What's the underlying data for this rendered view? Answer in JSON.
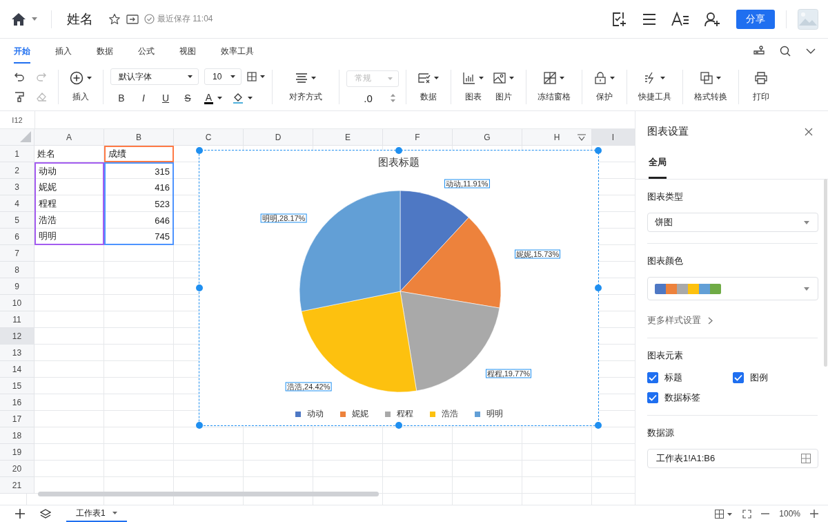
{
  "header": {
    "title": "姓名",
    "save_status": "最近保存 11:04",
    "share_button": "分享"
  },
  "tabs": [
    {
      "label": "开始",
      "selected": true
    },
    {
      "label": "插入",
      "selected": false
    },
    {
      "label": "数据",
      "selected": false
    },
    {
      "label": "公式",
      "selected": false
    },
    {
      "label": "视图",
      "selected": false
    },
    {
      "label": "效率工具",
      "selected": false
    }
  ],
  "toolbar": {
    "history": [
      {
        "kind": "undo",
        "disabled": false
      },
      {
        "kind": "redo",
        "disabled": true
      },
      {
        "kind": "painter",
        "disabled": false
      },
      {
        "kind": "eraser",
        "disabled": true
      }
    ],
    "insert_button": "插入",
    "font_select": "默认字体",
    "size_select": "10",
    "format_buttons": [
      {
        "label": "B",
        "kind": "bold"
      },
      {
        "label": "I",
        "kind": "italic"
      },
      {
        "label": "U",
        "kind": "underline"
      },
      {
        "label": "S",
        "kind": "strike"
      },
      {
        "label": "A",
        "kind": "font_color",
        "color": "#000000"
      },
      {
        "kind": "fill_color",
        "color": "#4fb0dc"
      }
    ],
    "align_button": "对齐方式",
    "number_format": {
      "value": "常规",
      "disabled": true
    },
    "decimal": ".0",
    "buttons": [
      {
        "label": "数据",
        "kind": "data",
        "dropdown": true
      },
      {
        "label": "图表",
        "kind": "chart",
        "dropdown": true
      },
      {
        "label": "图片",
        "kind": "image",
        "dropdown": true
      },
      {
        "label": "冻结窗格",
        "kind": "freeze",
        "dropdown": true
      },
      {
        "label": "保护",
        "kind": "lock",
        "dropdown": true
      },
      {
        "label": "快捷工具",
        "kind": "bolt",
        "dropdown": true
      },
      {
        "label": "格式转换",
        "kind": "convert",
        "dropdown": true
      },
      {
        "label": "打印",
        "kind": "print",
        "dropdown": false
      }
    ]
  },
  "name_box": "I12",
  "sheet": {
    "columns": [
      {
        "label": "A",
        "selected": false
      },
      {
        "label": "B",
        "selected": false
      },
      {
        "label": "C",
        "selected": false
      },
      {
        "label": "D",
        "selected": false
      },
      {
        "label": "E",
        "selected": false
      },
      {
        "label": "F",
        "selected": false
      },
      {
        "label": "G",
        "selected": false
      },
      {
        "label": "H",
        "selected": false,
        "menu": true
      },
      {
        "label": "I",
        "selected": true
      }
    ],
    "rows": [
      {
        "label": "1",
        "selected": false,
        "cells": [
          {
            "text": "姓名",
            "kind": "text"
          },
          {
            "text": "成绩",
            "kind": "text",
            "color": "#ff7a45"
          }
        ]
      },
      {
        "label": "2",
        "selected": false,
        "cells": [
          {
            "text": "动动",
            "kind": "text",
            "color": "#a35cf0"
          },
          {
            "text": "315",
            "kind": "number",
            "color": "#4d94ff"
          }
        ]
      },
      {
        "label": "3",
        "selected": false,
        "cells": [
          {
            "text": "妮妮",
            "kind": "text",
            "color": "#a35cf0"
          },
          {
            "text": "416",
            "kind": "number",
            "color": "#4d94ff"
          }
        ]
      },
      {
        "label": "4",
        "selected": false,
        "cells": [
          {
            "text": "程程",
            "kind": "text",
            "color": "#a35cf0"
          },
          {
            "text": "523",
            "kind": "number",
            "color": "#4d94ff"
          }
        ]
      },
      {
        "label": "5",
        "selected": false,
        "cells": [
          {
            "text": "浩浩",
            "kind": "text",
            "color": "#a35cf0"
          },
          {
            "text": "646",
            "kind": "number",
            "color": "#4d94ff"
          }
        ]
      },
      {
        "label": "6",
        "selected": false,
        "cells": [
          {
            "text": "明明",
            "kind": "text",
            "color": "#a35cf0"
          },
          {
            "text": "745",
            "kind": "number",
            "color": "#4d94ff"
          }
        ]
      },
      {
        "label": "7",
        "selected": false
      },
      {
        "label": "8",
        "selected": false
      },
      {
        "label": "9",
        "selected": false
      },
      {
        "label": "10",
        "selected": false
      },
      {
        "label": "11",
        "selected": false
      },
      {
        "label": "12",
        "selected": true
      },
      {
        "label": "13",
        "selected": false
      },
      {
        "label": "14",
        "selected": false
      },
      {
        "label": "15",
        "selected": false
      },
      {
        "label": "16",
        "selected": false
      },
      {
        "label": "17",
        "selected": false
      },
      {
        "label": "18",
        "selected": false
      },
      {
        "label": "19",
        "selected": false
      },
      {
        "label": "20",
        "selected": false
      },
      {
        "label": "21",
        "selected": false
      }
    ]
  },
  "chart": {
    "selected": true,
    "chart_data": {
      "type": "pie",
      "title": "图表标题",
      "legend": "bottom",
      "categories": [
        "动动",
        "妮妮",
        "程程",
        "浩浩",
        "明明"
      ],
      "series": [
        {
          "values": [
            11.91,
            15.73,
            19.77,
            24.42,
            28.17
          ]
        }
      ],
      "colors": [
        "#4e78c4",
        "#ed823c",
        "#a9a9a9",
        "#fdc10f",
        "#629fd6"
      ],
      "value_labels": [
        "动动,11.91%",
        "妮妮,15.73%",
        "程程,19.77%",
        "浩浩,24.42%",
        "明明,28.17%"
      ]
    }
  },
  "sheet_tabs": [
    {
      "label": "工作表1",
      "selected": true
    }
  ],
  "zoom": "100%",
  "panel": {
    "title": "图表设置",
    "tabs": [
      {
        "label": "全局",
        "selected": true
      }
    ],
    "type_label": "图表类型",
    "type_value": "饼图",
    "color_label": "图表颜色",
    "swatches": [
      {
        "color": "#4e78c4"
      },
      {
        "color": "#ed823c"
      },
      {
        "color": "#a9a9a9"
      },
      {
        "color": "#fdc10f"
      },
      {
        "color": "#629fd6"
      },
      {
        "color": "#6fab45"
      }
    ],
    "more_link": "更多样式设置",
    "elements_label": "图表元素",
    "elements": [
      {
        "label": "标题",
        "checked": true
      },
      {
        "label": "图例",
        "checked": true
      },
      {
        "label": "数据标签",
        "checked": true
      }
    ],
    "source_label": "数据源",
    "source_value": "工作表1!A1:B6"
  }
}
